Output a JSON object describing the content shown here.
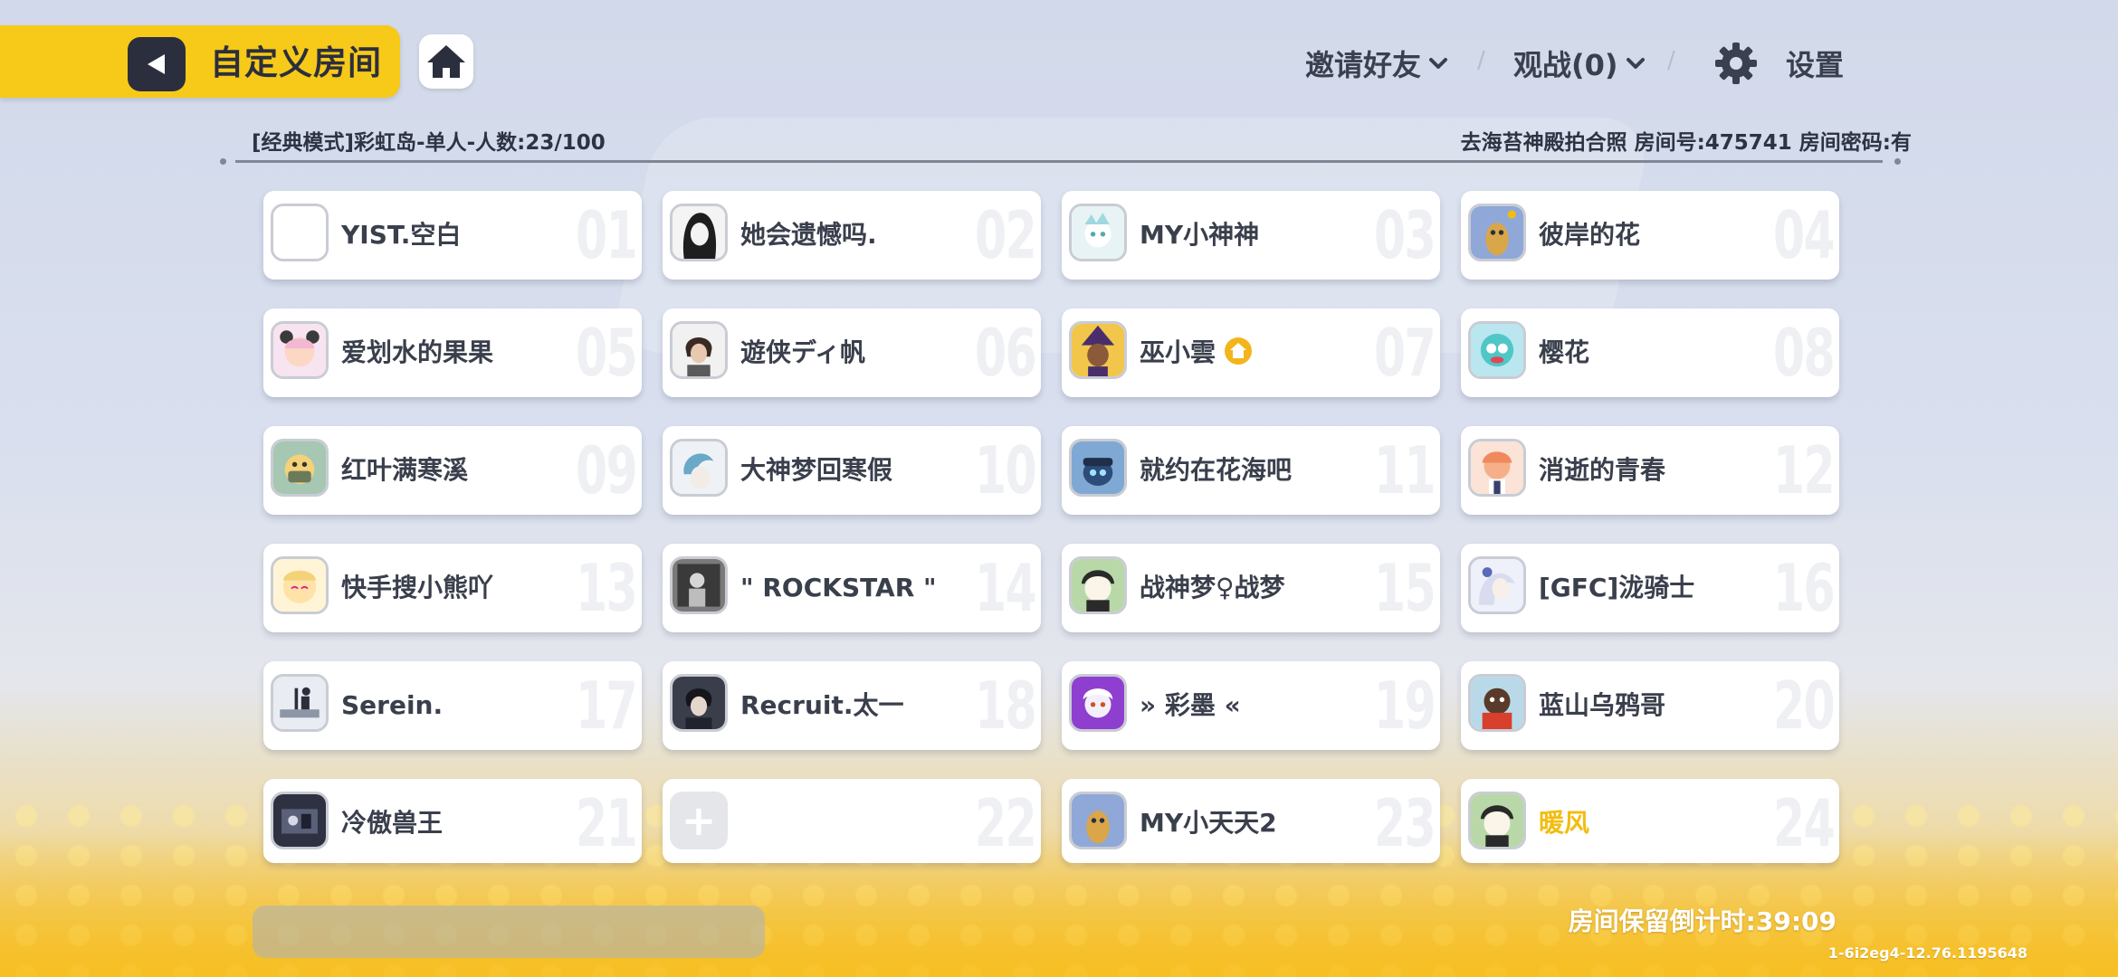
{
  "header": {
    "title": "自定义房间",
    "invite_label": "邀请好友",
    "spectate_label": "观战(0)",
    "settings_label": "设置",
    "separator": "/"
  },
  "room_info": {
    "mode_summary": "[经典模式]彩虹岛-单人-人数:23/100",
    "room_details": "去海苔神殿拍合照 房间号:475741 房间密码:有"
  },
  "slots": [
    {
      "num": "01",
      "name": "YIST.空白"
    },
    {
      "num": "02",
      "name": "她会遗憾吗."
    },
    {
      "num": "03",
      "name": "MY小神神"
    },
    {
      "num": "04",
      "name": "彼岸的花"
    },
    {
      "num": "05",
      "name": "爱划水的果果"
    },
    {
      "num": "06",
      "name": "遊侠ディ帆"
    },
    {
      "num": "07",
      "name": "巫小雲",
      "owner": true
    },
    {
      "num": "08",
      "name": "樱花"
    },
    {
      "num": "09",
      "name": "红叶满寒溪"
    },
    {
      "num": "10",
      "name": "大神梦回寒假"
    },
    {
      "num": "11",
      "name": "就约在花海吧"
    },
    {
      "num": "12",
      "name": "消逝的青春"
    },
    {
      "num": "13",
      "name": "快手搜小熊吖"
    },
    {
      "num": "14",
      "name": "\" ROCKSTAR \""
    },
    {
      "num": "15",
      "name": "战神梦♀战梦"
    },
    {
      "num": "16",
      "name": "[GFC]泷骑士"
    },
    {
      "num": "17",
      "name": "Serein."
    },
    {
      "num": "18",
      "name": "Recruit.太一"
    },
    {
      "num": "19",
      "name": "» 彩墨 «"
    },
    {
      "num": "20",
      "name": "蓝山乌鸦哥"
    },
    {
      "num": "21",
      "name": "冷傲兽王"
    },
    {
      "num": "22",
      "name": "",
      "empty": true,
      "add_symbol": "+"
    },
    {
      "num": "23",
      "name": "MY小天天2"
    },
    {
      "num": "24",
      "name": "暖风",
      "highlight": true
    }
  ],
  "footer": {
    "countdown": "房间保留倒计时:39:09",
    "version": "1-6i2eg4-12.76.1195648"
  },
  "icons": {
    "back": "back-arrow-icon",
    "home": "home-icon",
    "settings": "gear-icon",
    "dropdown": "chevron-down-icon",
    "owner": "room-owner-icon",
    "add": "add-player-icon"
  },
  "colors": {
    "accent_yellow": "#f7c918",
    "dark": "#2b2f3d",
    "highlight_name": "#f2bd10"
  }
}
